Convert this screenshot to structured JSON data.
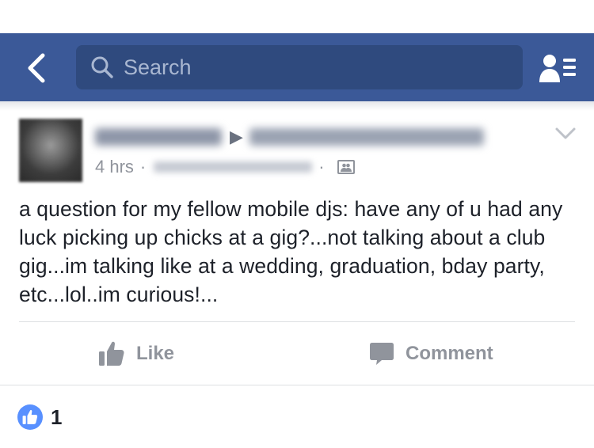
{
  "nav": {
    "back_icon": "chevron-left-icon",
    "search_placeholder": "Search",
    "search_icon": "search-icon",
    "friends_icon": "friend-requests-icon",
    "bar_color": "#3b5998"
  },
  "post": {
    "timestamp": "4 hrs",
    "meta_separator": "·",
    "body": "a question for my fellow mobile djs: have any of u had any luck picking up chicks at a gig?...not talking about a club gig...im talking like at a wedding, graduation, bday party, etc...lol..im curious!...",
    "options_icon": "chevron-down-icon",
    "privacy_icon": "group-audience-icon"
  },
  "actions": {
    "like_label": "Like",
    "comment_label": "Comment"
  },
  "reactions": {
    "count": "1",
    "badge_icon": "like-badge-icon",
    "badge_color": "#5890ff"
  }
}
